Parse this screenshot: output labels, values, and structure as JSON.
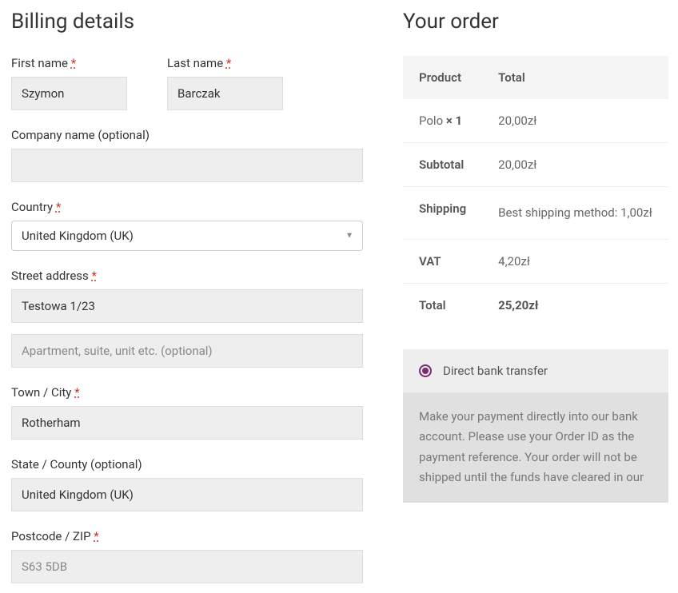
{
  "billing": {
    "heading": "Billing details",
    "first_name_label": "First name",
    "first_name_value": "Szymon",
    "last_name_label": "Last name",
    "last_name_value": "Barczak",
    "company_label": "Company name (optional)",
    "company_value": "",
    "country_label": "Country",
    "country_value": "United Kingdom (UK)",
    "street_label": "Street address",
    "street_value": "Testowa 1/23",
    "apt_placeholder": "Apartment, suite, unit etc. (optional)",
    "apt_value": "",
    "city_label": "Town / City",
    "city_value": "Rotherham",
    "state_label": "State / County (optional)",
    "state_value": "United Kingdom (UK)",
    "postcode_label": "Postcode / ZIP",
    "postcode_placeholder": "S63 5DB",
    "required_mark": "*"
  },
  "order": {
    "heading": "Your order",
    "th_product": "Product",
    "th_total": "Total",
    "item_name": "Polo ",
    "item_qty": "× 1",
    "item_total": "20,00zł",
    "subtotal_label": "Subtotal",
    "subtotal_value": "20,00zł",
    "shipping_label": "Shipping",
    "shipping_value": "Best shipping method: 1,00zł",
    "vat_label": "VAT",
    "vat_value": "4,20zł",
    "total_label": "Total",
    "total_value": "25,20zł"
  },
  "payment": {
    "option_label": "Direct bank transfer",
    "desc": "Make your payment directly into our bank account. Please use your Order ID as the payment reference. Your order will not be shipped until the funds have cleared in our"
  }
}
